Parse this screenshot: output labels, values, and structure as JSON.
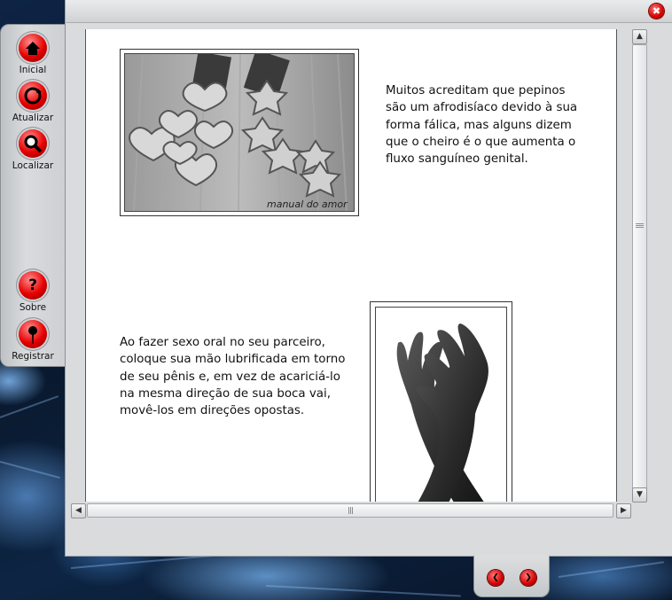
{
  "window": {
    "close_glyph": "✖"
  },
  "toolbar": {
    "items": [
      {
        "label": "Inicial",
        "icon": "home-icon"
      },
      {
        "label": "Atualizar",
        "icon": "refresh-icon"
      },
      {
        "label": "Localizar",
        "icon": "search-icon"
      },
      {
        "label": "Sobre",
        "icon": "help-icon"
      },
      {
        "label": "Registrar",
        "icon": "pin-icon"
      }
    ]
  },
  "content": {
    "para1": "Muitos acreditam que pepinos são um afrodisíaco devido à sua forma fálica, mas alguns dizem que o cheiro é o que aumenta o fluxo sanguíneo genital.",
    "para2": "Ao fazer sexo oral no seu parceiro, coloque sua mão lubrificada em torno de seu pênis e, em vez de acariciá-lo na mesma direção de sua boca vai, movê-los em direções opostas.",
    "photo1_watermark": "manual do amor",
    "photo1_icon": "cucumber-slices-photo",
    "photo2_icon": "crossed-hands-photo"
  },
  "nav": {
    "prev_glyph": "❮",
    "next_glyph": "❯"
  },
  "colors": {
    "accent_red": "#e60000",
    "panel_gray": "#d9dbdd"
  }
}
